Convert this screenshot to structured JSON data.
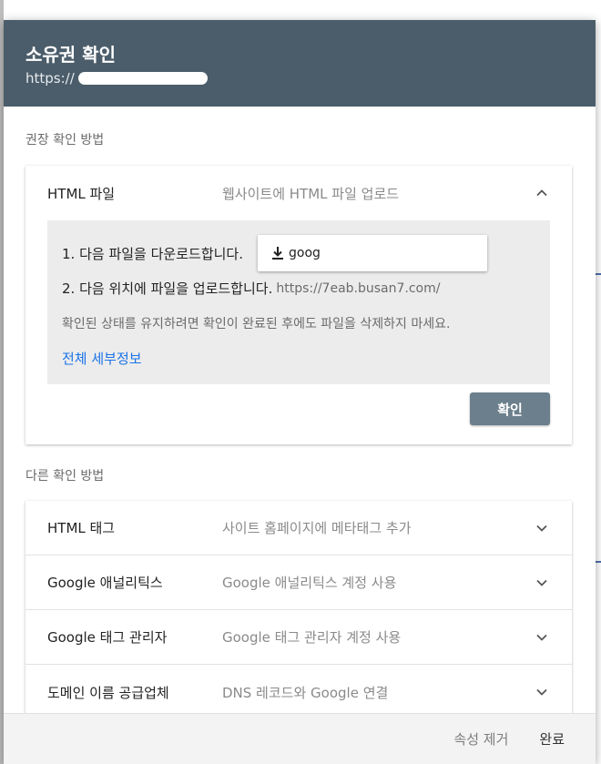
{
  "dialog": {
    "title": "소유권 확인",
    "url_prefix": "https://"
  },
  "recommended": {
    "label": "권장 확인 방법",
    "method": {
      "name": "HTML 파일",
      "description": "웹사이트에 HTML 파일 업로드"
    },
    "steps": {
      "step1": "1. 다음 파일을 다운로드합니다.",
      "download_label": "goog",
      "step2": "2. 다음 위치에 파일을 업로드합니다.",
      "upload_url": "https://7eab.busan7.com/",
      "note": "확인된 상태를 유지하려면 확인이 완료된 후에도 파일을 삭제하지 마세요.",
      "details_link": "전체 세부정보"
    },
    "confirm_label": "확인"
  },
  "other": {
    "label": "다른 확인 방법",
    "methods": [
      {
        "name": "HTML 태그",
        "description": "사이트 홈페이지에 메타태그 추가"
      },
      {
        "name": "Google 애널리틱스",
        "description": "Google 애널리틱스 계정 사용"
      },
      {
        "name": "Google 태그 관리자",
        "description": "Google 태그 관리자 계정 사용"
      },
      {
        "name": "도메인 이름 공급업체",
        "description": "DNS 레코드와 Google 연결"
      }
    ]
  },
  "footer": {
    "remove_label": "속성 제거",
    "done_label": "완료"
  },
  "colors": {
    "header_bg": "#4b5d6a",
    "confirm_bg": "#6b7f8c",
    "link": "#1a73e8"
  },
  "icons": {
    "expand": "chevron-up-icon",
    "collapse": "chevron-down-icon",
    "download": "download-icon"
  }
}
